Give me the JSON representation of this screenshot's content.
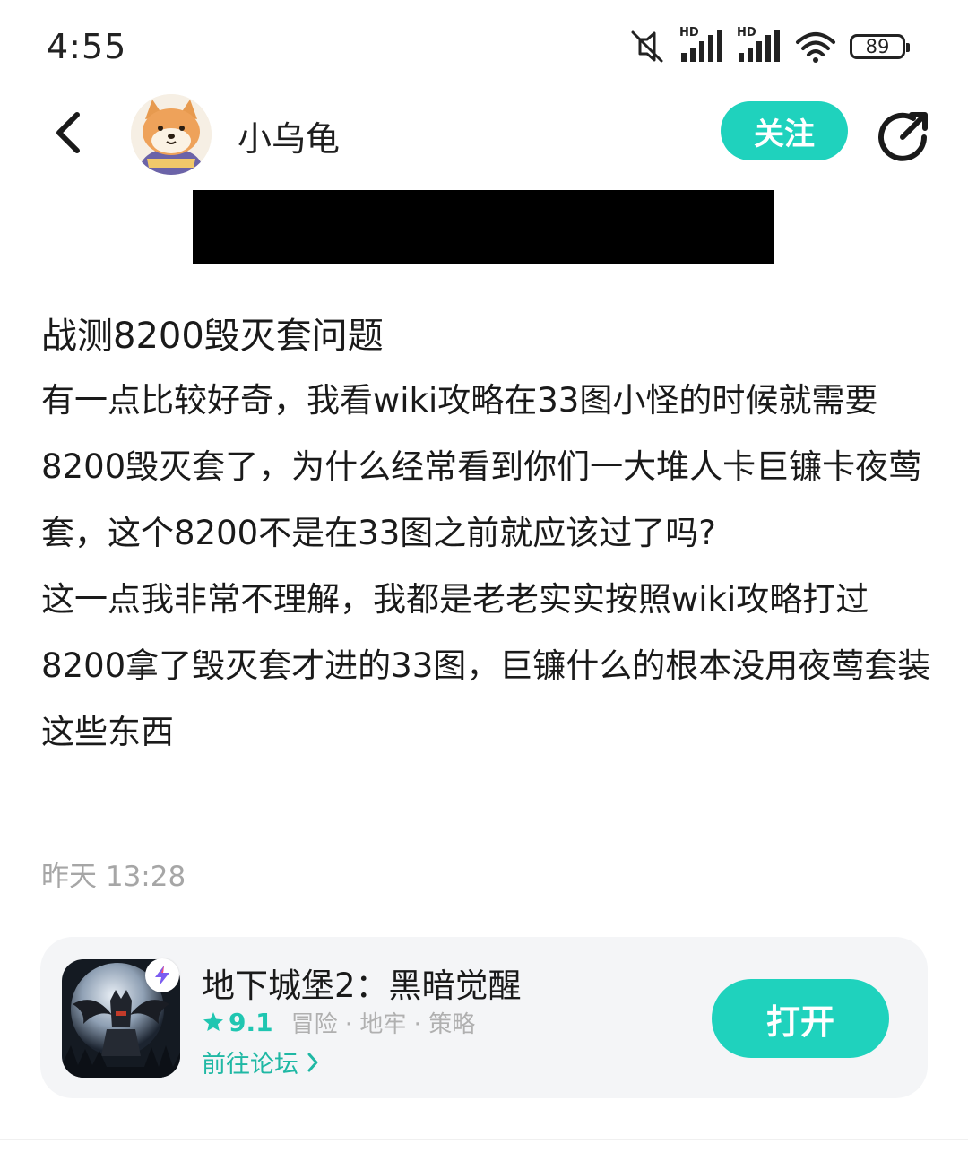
{
  "status_bar": {
    "time": "4:55",
    "hd_label_1": "HD",
    "hd_label_2": "HD",
    "battery": "89",
    "icons": [
      "mute-icon",
      "signal-icon",
      "signal-icon",
      "wifi-icon",
      "battery-icon"
    ]
  },
  "header": {
    "username": "小乌龟",
    "follow_label": "关注",
    "back_icon": "chevron-left-icon",
    "share_icon": "share-icon"
  },
  "post": {
    "title": "战测8200毁灭套问题",
    "paragraphs": [
      "有一点比较好奇，我看wiki攻略在33图小怪的时候就需要8200毁灭套了，为什么经常看到你们一大堆人卡巨镰卡夜莺套，这个8200不是在33图之前就应该过了吗?",
      "这一点我非常不理解，我都是老老实实按照wiki攻略打过8200拿了毁灭套才进的33图，巨镰什么的根本没用夜莺套装这些东西"
    ],
    "time": "昨天 13:28"
  },
  "game_card": {
    "name": "地下城堡2：黑暗觉醒",
    "rating": "9.1",
    "tags": "冒险 · 地牢 · 策略",
    "forum_link": "前往论坛",
    "open_label": "打开"
  },
  "colors": {
    "accent": "#1fd2bd",
    "link": "#1fb8a4",
    "muted": "#a6a6a6",
    "card_bg": "#f4f5f7"
  }
}
